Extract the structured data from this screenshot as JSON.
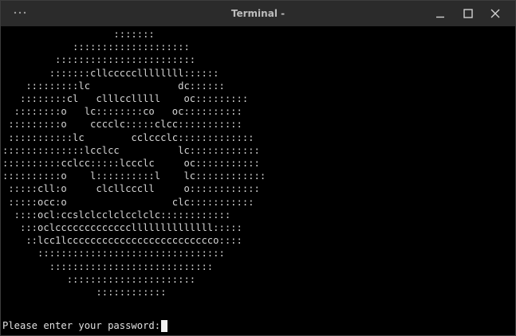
{
  "window": {
    "title": "Terminal -"
  },
  "icons": {
    "menu": "more-horizontal-icon",
    "minimize": "minimize-icon",
    "maximize": "maximize-icon",
    "close": "close-icon"
  },
  "colors": {
    "titlebar": "#2b2b2b",
    "terminal_background": "#000000",
    "terminal_text": "#d4d4d4"
  },
  "terminal": {
    "ascii_art": "                   :::::::\n            ::::::::::::::::::::\n         ::::::::::::::::::::::::\n        :::::::cllcccccllllllll::::::\n    :::::::::lc               dc::::::\n   ::::::::cl   clllcclllll    oc:::::::::\n  ::::::::o   lc::::::::co   oc::::::::::\n :::::::::o    cccclc:::::clcc:::::::::::\n :::::::::::lc        cclccclc:::::::::::::\n::::::::::::::lcclcc          lc::::::::::::\n::::::::::cclcc:::::lccclc     oc:::::::::::\n::::::::::o    l::::::::::l    lc::::::::::::\n :::::cll:o     clcllcccll     o::::::::::::\n :::::occ:o                  clc:::::::::::\n  ::::ocl:ccslclcclclcclclc::::::::::::\n   :::oclcccccccccccccllllllllllllll:::::\n    ::lcc1lccccccccccccccccccccccccco::::\n      ::::::::::::::::::::::::::::::::\n        ::::::::::::::::::::::::::::\n           ::::::::::::::::::::::\n                ::::::::::::",
    "prompt": "Please enter your password:"
  }
}
